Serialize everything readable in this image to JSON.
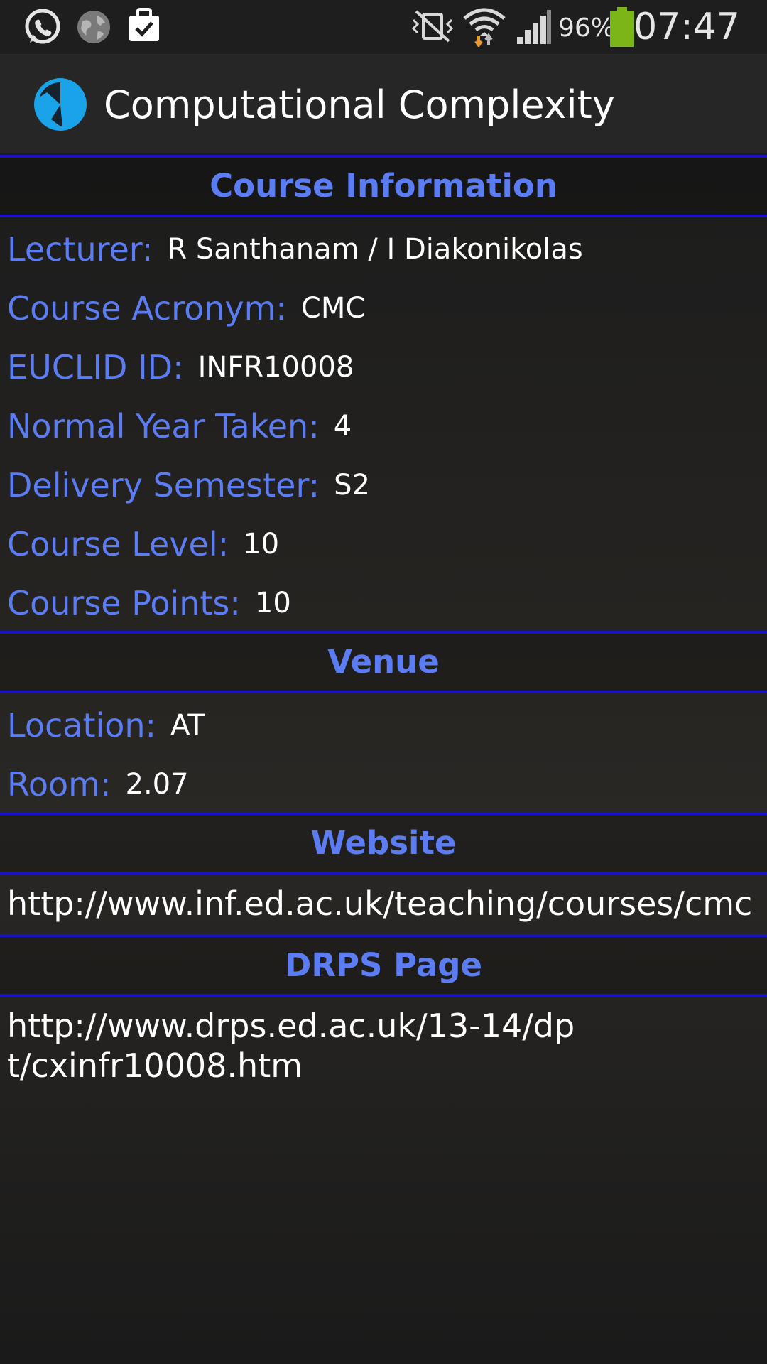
{
  "status_bar": {
    "battery_percent": "96%",
    "time": "07:47",
    "icons": [
      "whatsapp-icon",
      "globe-icon",
      "clipboard-check-icon",
      "vibrate-mute-icon",
      "wifi-icon",
      "signal-icon",
      "battery-icon"
    ],
    "battery_color": "#7cb518"
  },
  "action_bar": {
    "title": "Computational Complexity",
    "icon": "clock-icon",
    "icon_color": "#1aa3e8"
  },
  "colors": {
    "accent": "#5b7cf2",
    "divider": "#1a11c9",
    "background": "#1b1b1b"
  },
  "course_information": {
    "header": "Course Information",
    "fields": [
      {
        "label": "Lecturer:",
        "value": "R Santhanam / I Diakonikolas"
      },
      {
        "label": "Course Acronym:",
        "value": "CMC"
      },
      {
        "label": "EUCLID ID:",
        "value": "INFR10008"
      },
      {
        "label": "Normal Year Taken:",
        "value": "4"
      },
      {
        "label": "Delivery Semester:",
        "value": "S2"
      },
      {
        "label": "Course Level:",
        "value": "10"
      },
      {
        "label": "Course Points:",
        "value": "10"
      }
    ]
  },
  "venue": {
    "header": "Venue",
    "fields": [
      {
        "label": "Location:",
        "value": "AT"
      },
      {
        "label": "Room:",
        "value": "2.07"
      }
    ]
  },
  "website": {
    "header": "Website",
    "url": "http://www.inf.ed.ac.uk/teaching/courses/cmc"
  },
  "drps": {
    "header": "DRPS Page",
    "url": "http://www.drps.ed.ac.uk/13-14/dpt/cxinfr10008.htm"
  }
}
